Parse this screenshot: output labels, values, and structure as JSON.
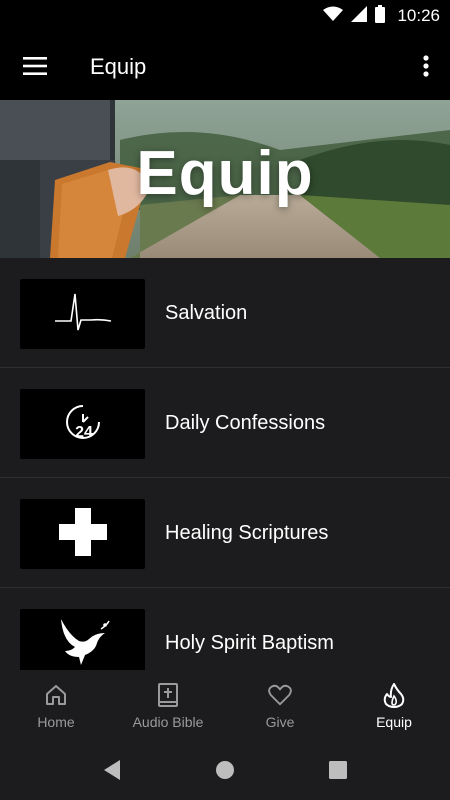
{
  "status_bar": {
    "time": "10:26",
    "icons": [
      "wifi-icon",
      "signal-icon",
      "battery-icon"
    ]
  },
  "app_bar": {
    "title": "Equip",
    "menu_icon": "hamburger-menu-icon",
    "more_icon": "more-vert-icon"
  },
  "hero": {
    "title": "Equip"
  },
  "list": {
    "items": [
      {
        "label": "Salvation",
        "icon": "heartbeat-icon"
      },
      {
        "label": "Daily Confessions",
        "icon": "clock-24-icon"
      },
      {
        "label": "Healing Scriptures",
        "icon": "cross-icon"
      },
      {
        "label": "Holy Spirit Baptism",
        "icon": "dove-icon"
      }
    ]
  },
  "bottom_nav": {
    "items": [
      {
        "label": "Home",
        "icon": "home-icon",
        "active": false
      },
      {
        "label": "Audio Bible",
        "icon": "bible-icon",
        "active": false
      },
      {
        "label": "Give",
        "icon": "heart-icon",
        "active": false
      },
      {
        "label": "Equip",
        "icon": "flame-icon",
        "active": true
      }
    ]
  },
  "system_nav": {
    "buttons": [
      "back-icon",
      "home-circle-icon",
      "recents-icon"
    ]
  },
  "colors": {
    "background": "#000000",
    "list_background": "#1c1c1e",
    "text": "#ffffff",
    "inactive": "#9a9a9a"
  }
}
